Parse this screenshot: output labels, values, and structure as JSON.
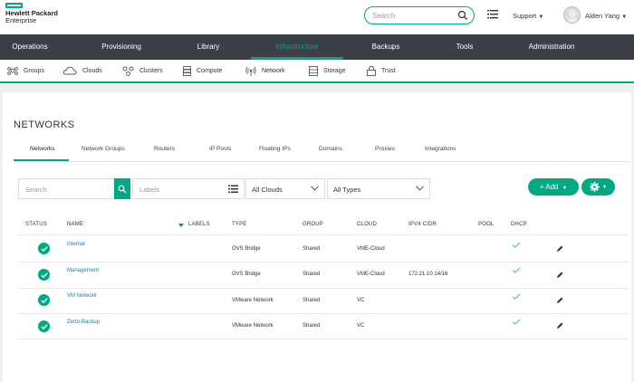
{
  "header": {
    "brand_line1": "Hewlett Packard",
    "brand_line2": "Enterprise",
    "search_placeholder": "Search",
    "support_label": "Support",
    "user_name": "Alden Yang"
  },
  "main_nav": {
    "items": [
      {
        "label": "Operations",
        "active": false
      },
      {
        "label": "Provisioning",
        "active": false
      },
      {
        "label": "Library",
        "active": false
      },
      {
        "label": "Infrastructure",
        "active": true
      },
      {
        "label": "Backups",
        "active": false
      },
      {
        "label": "Tools",
        "active": false
      },
      {
        "label": "Administration",
        "active": false
      }
    ]
  },
  "sub_nav": {
    "items": [
      {
        "label": "Groups",
        "icon": "groups-icon"
      },
      {
        "label": "Clouds",
        "icon": "cloud-icon"
      },
      {
        "label": "Clusters",
        "icon": "clusters-icon"
      },
      {
        "label": "Compute",
        "icon": "compute-icon"
      },
      {
        "label": "Network",
        "icon": "network-icon"
      },
      {
        "label": "Storage",
        "icon": "storage-icon"
      },
      {
        "label": "Trust",
        "icon": "lock-icon"
      }
    ]
  },
  "page": {
    "title": "NETWORKS",
    "tabs": [
      {
        "label": "Networks",
        "active": true
      },
      {
        "label": "Network Groups",
        "active": false
      },
      {
        "label": "Routers",
        "active": false
      },
      {
        "label": "IP Pools",
        "active": false
      },
      {
        "label": "Floating IPs",
        "active": false
      },
      {
        "label": "Domains",
        "active": false
      },
      {
        "label": "Proxies",
        "active": false
      },
      {
        "label": "Integrations",
        "active": false
      }
    ]
  },
  "filters": {
    "search_placeholder": "Search",
    "labels_placeholder": "Labels",
    "cloud_filter": "All Clouds",
    "type_filter": "All Types",
    "add_label": "+ Add"
  },
  "table": {
    "columns": [
      "STATUS",
      "NAME",
      "LABELS",
      "TYPE",
      "GROUP",
      "CLOUD",
      "IPV4 CIDR",
      "POOL",
      "DHCP"
    ],
    "rows": [
      {
        "status": "ok",
        "name": "internal",
        "labels": "",
        "type": "OVS Bridge",
        "group": "Shared",
        "cloud": "VME-Cloud",
        "ipv4_cidr": "",
        "pool": "",
        "dhcp": true
      },
      {
        "status": "ok",
        "name": "Management",
        "labels": "",
        "type": "OVS Bridge",
        "group": "Shared",
        "cloud": "VME-Cloud",
        "ipv4_cidr": "172.21.10.14/16",
        "pool": "",
        "dhcp": true
      },
      {
        "status": "ok",
        "name": "VM Network",
        "labels": "",
        "type": "VMware Network",
        "group": "Shared",
        "cloud": "VC",
        "ipv4_cidr": "",
        "pool": "",
        "dhcp": true
      },
      {
        "status": "ok",
        "name": "Zerto-Backup",
        "labels": "",
        "type": "VMware Network",
        "group": "Shared",
        "cloud": "VC",
        "ipv4_cidr": "",
        "pool": "",
        "dhcp": true
      }
    ]
  },
  "colors": {
    "accent": "#01a982",
    "nav_bg": "#3a3f48",
    "link": "#1f7aa8"
  }
}
